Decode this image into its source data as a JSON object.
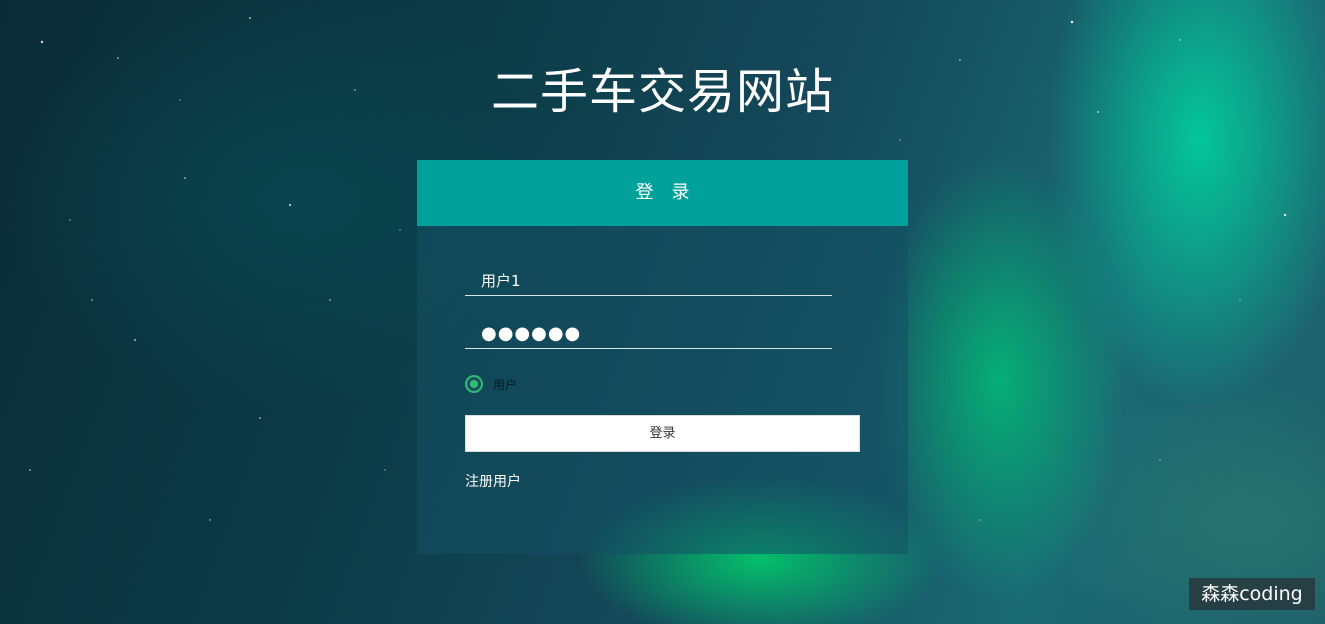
{
  "site": {
    "title": "二手车交易网站"
  },
  "login_panel": {
    "header": "登　录",
    "username_value": "用户1",
    "password_mask": "●●●●●●",
    "role_option": "用户",
    "submit_label": "登录",
    "register_link": "注册用户"
  },
  "watermark": {
    "text": "森森coding"
  },
  "colors": {
    "header_bg": "#00a19a",
    "radio_accent": "#2fbf72",
    "panel_bg": "rgba(20, 80, 100, 0.55)"
  }
}
